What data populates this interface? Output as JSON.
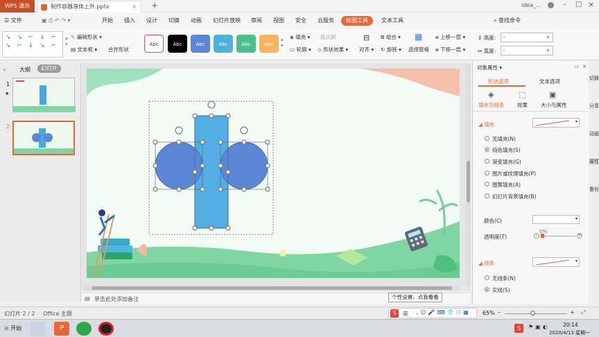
{
  "titlebar": {
    "app": "WPS 演示",
    "doc_tab": "制作容器液体上升.pptx",
    "new_tab": "+",
    "user": "idea_..."
  },
  "menubar": {
    "file": "文件",
    "items": [
      "开始",
      "插入",
      "设计",
      "切换",
      "动画",
      "幻灯片放映",
      "审阅",
      "视图",
      "安全",
      "云服务"
    ],
    "active": "绘图工具",
    "text_tools": "文本工具",
    "search": "查找命令"
  },
  "ribbon": {
    "edit_shape": "编辑形状",
    "textbox": "文本框",
    "merge_shape": "合并形状",
    "styles": [
      {
        "label": "Abc",
        "bg": "#ffffff",
        "fg": "#333333",
        "border": "#e0504d"
      },
      {
        "label": "Abc",
        "bg": "#000000",
        "fg": "#ffffff",
        "border": "#000000"
      },
      {
        "label": "Abc",
        "bg": "#5b87d6",
        "fg": "#ffffff",
        "border": "#5b87d6"
      },
      {
        "label": "Abc",
        "bg": "#4fb0dc",
        "fg": "#ffffff",
        "border": "#4fb0dc"
      },
      {
        "label": "Abc",
        "bg": "#4bbf8e",
        "fg": "#ffffff",
        "border": "#4bbf8e"
      },
      {
        "label": "Abc",
        "bg": "#f7b45a",
        "fg": "#ffffff",
        "border": "#f7b45a"
      }
    ],
    "fill": "填充",
    "format_painter": "格式刷",
    "outline": "轮廓",
    "shape_effect": "形状效果",
    "align": "对齐",
    "group": "组合",
    "rotate": "旋转",
    "selection_pane": "选择窗格",
    "bring_forward": "上移一层",
    "send_backward": "下移一层",
    "height": "高度:",
    "width": "宽度:"
  },
  "leftpanel": {
    "tab_outline": "大纲",
    "tab_slides": "幻灯片",
    "slide1": "1",
    "slide2": "2",
    "star": "★"
  },
  "slide": {
    "notes_placeholder": "单击此处添加备注"
  },
  "rightpanel": {
    "title": "对象属性",
    "tab_shape": "形状选项",
    "tab_text": "文本选项",
    "sub_fill_line": "填充与线条",
    "sub_effect": "效果",
    "sub_size": "大小与属性",
    "fill_header": "填充",
    "fill_options": [
      "无填充(N)",
      "纯色填充(S)",
      "渐变填充(G)",
      "图片或纹理填充(P)",
      "图案填充(A)",
      "幻灯片背景填充(B)"
    ],
    "fill_selected": 1,
    "color_label": "颜色(C)",
    "transparency_label": "透明度(T)",
    "transparency_value": "0%",
    "line_header": "线条",
    "line_options": [
      "无线条(N)",
      "实线(S)"
    ],
    "line_selected": 1,
    "tooltip": "个性设置，点我看看"
  },
  "sidebar": [
    "切换",
    "分享",
    "动画",
    "属性",
    "备份"
  ],
  "statusbar": {
    "slide_info": "幻灯片 2 / 2",
    "theme": "Office 主题",
    "zoom": "65%"
  },
  "taskbar": {
    "start": "开始",
    "time": "20:14",
    "date": "2020/4/13 星期一"
  },
  "imeBar": {
    "label": "英"
  }
}
